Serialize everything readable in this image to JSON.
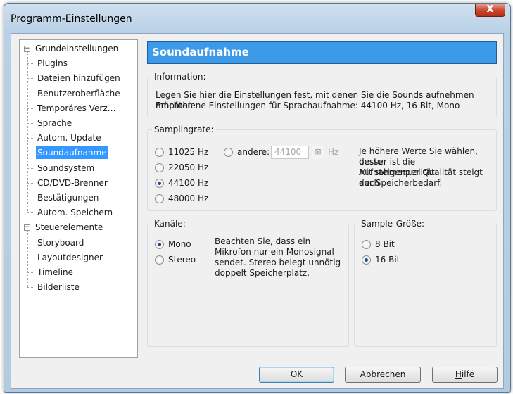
{
  "window": {
    "title": "Programm-Einstellungen",
    "close_symbol": "X"
  },
  "tree": {
    "groups": [
      {
        "label": "Grundeinstellungen",
        "expanded": true,
        "children": [
          "Plugins",
          "Dateien hinzufügen",
          "Benutzeroberfläche",
          "Temporäres Verz…",
          "Sprache",
          "Autom. Update",
          "Soundaufnahme",
          "Soundsystem",
          "CD/DVD-Brenner",
          "Bestätigungen",
          "Autom. Speichern"
        ]
      },
      {
        "label": "Steuerelemente",
        "expanded": true,
        "children": [
          "Storyboard",
          "Layoutdesigner",
          "Timeline",
          "Bilderliste"
        ]
      }
    ],
    "selected": "Soundaufnahme"
  },
  "panel": {
    "title": "Soundaufnahme",
    "header_color": "#3d9ae8",
    "information": {
      "legend": "Information:",
      "line1": "Legen Sie hier die Einstellungen fest, mit denen Sie die Sounds aufnehmen möchten.",
      "line2": "Empfohlene Einstellungen für Sprachaufnahme: 44100 Hz, 16 Bit, Mono"
    },
    "samplingrate": {
      "legend": "Samplingrate:",
      "options": [
        "11025 Hz",
        "22050 Hz",
        "44100 Hz",
        "48000 Hz"
      ],
      "selected": "44100 Hz",
      "other_label": "andere:",
      "other_value": "44100",
      "other_unit": "Hz",
      "calc_icon": "calculator-icon",
      "note": [
        "Je höhere Werte Sie wählen, desto",
        "besser ist die Aufnahmequalität.",
        "Mit steigender Qualität steigt auch",
        "der Speicherbedarf."
      ]
    },
    "kanaele": {
      "legend": "Kanäle:",
      "options": [
        "Mono",
        "Stereo"
      ],
      "selected": "Mono",
      "note": [
        "Beachten Sie, dass ein",
        "Mikrofon nur ein Monosignal",
        "sendet. Stereo belegt unnötig",
        "doppelt Speicherplatz."
      ]
    },
    "sample_groesse": {
      "legend": "Sample-Größe:",
      "options": [
        "8 Bit",
        "16 Bit"
      ],
      "selected": "16 Bit"
    }
  },
  "buttons": {
    "ok": "OK",
    "cancel": "Abbrechen",
    "help_first": "H",
    "help_rest": "ilfe"
  }
}
